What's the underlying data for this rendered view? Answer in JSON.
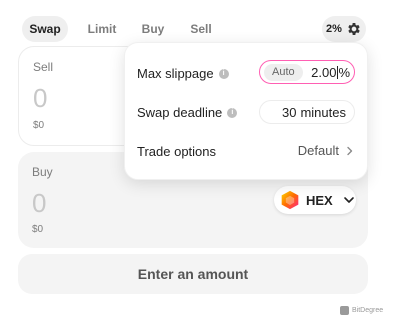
{
  "tabs": [
    {
      "label": "Swap",
      "active": true
    },
    {
      "label": "Limit",
      "active": false
    },
    {
      "label": "Buy",
      "active": false
    },
    {
      "label": "Sell",
      "active": false
    }
  ],
  "settings_button": {
    "slippage_badge": "2%",
    "icon": "gear-icon"
  },
  "sell": {
    "label": "Sell",
    "amount": "0",
    "usd": "$0"
  },
  "buy": {
    "label": "Buy",
    "amount": "0",
    "usd": "$0",
    "token": "HEX",
    "token_icon": "hex-logo-icon"
  },
  "cta_label": "Enter an amount",
  "settings": {
    "max_slippage": {
      "label": "Max slippage",
      "auto_label": "Auto",
      "value": "2.00",
      "unit": "%"
    },
    "swap_deadline": {
      "label": "Swap deadline",
      "value": "30",
      "unit": "minutes"
    },
    "trade_options": {
      "label": "Trade options",
      "value": "Default"
    }
  },
  "watermark": "BitDegree",
  "colors": {
    "accent_pink": "#ff5fb3",
    "panel_gray": "#f4f4f4",
    "hex_orange": "#ff6a00",
    "hex_pink": "#ff1f8f"
  }
}
